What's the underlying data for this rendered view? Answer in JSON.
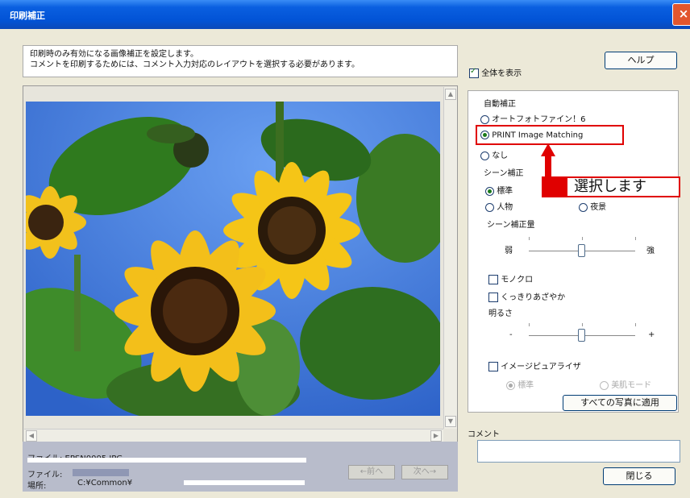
{
  "window": {
    "title": "印刷補正",
    "close_label": "×"
  },
  "description": {
    "line1": "印刷時のみ有効になる画像補正を設定します。",
    "line2": "コメントを印刷するためには、コメント入力対応のレイアウトを選択する必要があります。"
  },
  "show_all": {
    "label": "全体を表示",
    "checked": true
  },
  "help_button": "ヘルプ",
  "preview": {
    "file_label_top": "ファイル: EPSN0005.JPG",
    "file_label": "ファイル:",
    "location_label": "場所:",
    "location_value": "C:¥Common¥",
    "prev_button": "←前へ",
    "next_button": "次へ→"
  },
  "settings": {
    "auto_correction_label": "自動補正",
    "auto_options": [
      {
        "label": "オートフォトファイン！6",
        "selected": false
      },
      {
        "label": "PRINT Image Matching",
        "selected": true
      },
      {
        "label": "なし",
        "selected": false
      }
    ],
    "scene_label": "シーン補正",
    "scene_options": [
      {
        "label": "標準",
        "selected": true
      },
      {
        "label": "人物",
        "selected": false
      },
      {
        "label": "夜景",
        "selected": false
      }
    ],
    "scene_amount_label": "シーン補正量",
    "weak_label": "弱",
    "strong_label": "強",
    "mono_label": "モノクロ",
    "vivid_label": "くっきりあざやか",
    "brightness_label": "明るさ",
    "minus_label": "-",
    "plus_label": "+",
    "image_purifier_label": "イメージピュアライザ",
    "purifier_options": [
      {
        "label": "標準",
        "selected": true
      },
      {
        "label": "美肌モード",
        "selected": false
      }
    ],
    "apply_all_button": "すべての写真に適用"
  },
  "callout": {
    "text": "選択します",
    "color": "#e00000"
  },
  "comment": {
    "label": "コメント",
    "value": ""
  },
  "close_button": "閉じる"
}
